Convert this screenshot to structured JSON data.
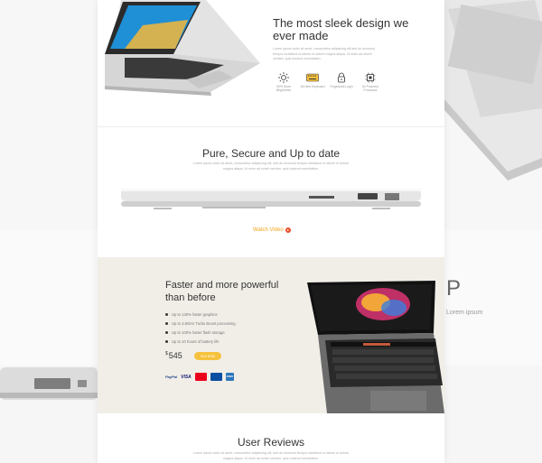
{
  "background": {
    "right_heading_fragment": "P",
    "right_body_fragment": "Lorem ipsum"
  },
  "sec1": {
    "title": "The most sleek design we ever made",
    "body": "Lorem ipsum dolor sit amet, consectetur adipiscing elit sed do eiusmod tempor incididunt ut labore et dolore magna aliqua. Ut enim ad minim veniam, quis nostrud exercitation.",
    "features": [
      {
        "icon": "sun-icon",
        "label": "50% More Brightness"
      },
      {
        "icon": "keyboard-icon",
        "label": "All New Keyboard"
      },
      {
        "icon": "lock-icon",
        "label": "Fingerprint Login"
      },
      {
        "icon": "chip-icon",
        "label": "5x Powerful Processor"
      }
    ]
  },
  "sec2": {
    "title": "Pure, Secure and Up to date",
    "body": "Lorem ipsum dolor sit amet, consectetur adipiscing elit, sed do eiusmod tempor incididunt ut labore et dolore magna aliqua. Ut enim ad minim veniam, quis nostrud exercitation.",
    "watch_label": "Watch Video"
  },
  "sec3": {
    "title": "Faster and more powerful than before",
    "bullets": [
      "Up to 130% faster graphics",
      "Up to 3.8GHz Turbo Boost processing",
      "Up to 100% faster flash storage",
      "Up to 10 hours of battery life"
    ],
    "price_currency": "$",
    "price_value": "545",
    "buy_label": "BUY NOW",
    "payments": {
      "paypal": "PayPal",
      "visa": "VISA",
      "amex": "AMEX"
    }
  },
  "sec4": {
    "title": "User Reviews",
    "body": "Lorem ipsum dolor sit amet, consectetur adipiscing elit, sed do eiusmod tempor incididunt ut labore et dolore magna aliqua. Ut enim ad minim veniam, quis nostrud exercitation."
  },
  "colors": {
    "accent": "#f2a31c",
    "buy_button": "#f6c23d",
    "band": "#f1eee8"
  }
}
